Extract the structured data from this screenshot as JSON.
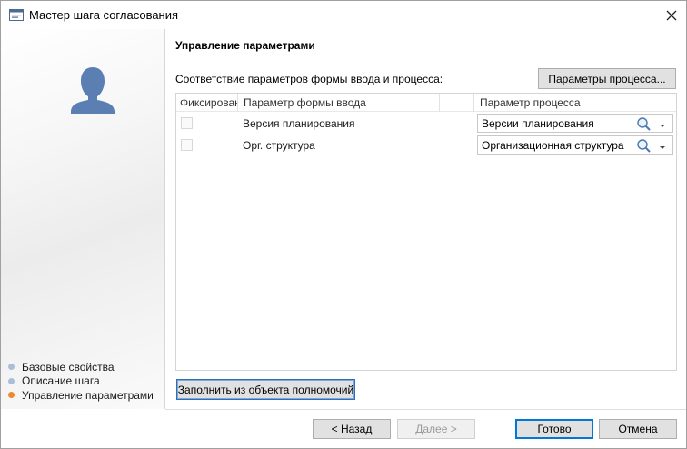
{
  "window": {
    "title": "Мастер шага согласования",
    "icon": "window-dialog-icon",
    "close_icon": "close-icon"
  },
  "sidebar": {
    "avatar_icon": "user-silhouette-icon",
    "steps": [
      {
        "label": "Базовые свойства",
        "color": "#a9bfd9",
        "active": false
      },
      {
        "label": "Описание шага",
        "color": "#a9bfd9",
        "active": false
      },
      {
        "label": "Управление параметрами",
        "color": "#f0882e",
        "active": true
      }
    ]
  },
  "main": {
    "heading": "Управление параметрами",
    "mapping_label": "Соответствие параметров формы ввода и процесса:",
    "process_params_button": "Параметры процесса...",
    "grid": {
      "columns": [
        "Фиксирован",
        "Параметр формы ввода",
        "Параметр процесса"
      ],
      "rows": [
        {
          "fixed": false,
          "form_param": "Версия планирования",
          "process_param": "Версии планирования"
        },
        {
          "fixed": false,
          "form_param": "Орг. структура",
          "process_param": "Организационная структура"
        }
      ]
    },
    "fill_button": "Заполнить из объекта полномочий"
  },
  "footer": {
    "back": "< Назад",
    "next": "Далее >",
    "done": "Готово",
    "cancel": "Отмена"
  },
  "colors": {
    "accent": "#0078d7",
    "avatar": "#5b7fb3"
  }
}
